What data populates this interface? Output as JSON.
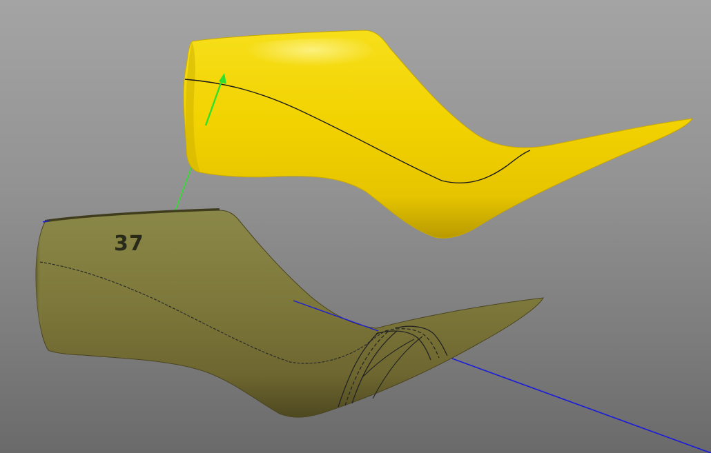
{
  "viewport": {
    "background_top": "#a4a4a4",
    "background_bottom": "#6a6a6a"
  },
  "models": {
    "scanned_last": {
      "surface_color": "#f2d200",
      "feature_line_color": "#1a1a1a"
    },
    "wooden_last": {
      "surface_color": "#8a8540",
      "size_mark": "37",
      "drawing_color": "#2a2a2a"
    }
  },
  "axes": {
    "y_axis_color": "#2ee02e",
    "z_axis_color": "#1a1adc"
  }
}
